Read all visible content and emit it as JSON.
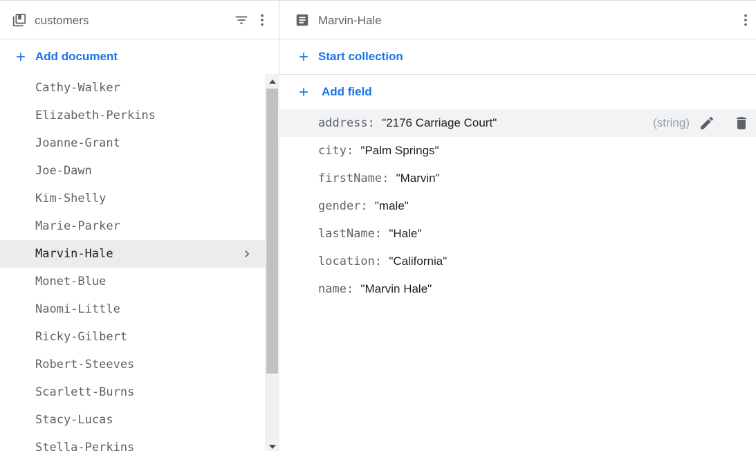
{
  "collection_panel": {
    "title": "customers",
    "add_document_label": "Add document",
    "documents": [
      "Cathy-Walker",
      "Elizabeth-Perkins",
      "Joanne-Grant",
      "Joe-Dawn",
      "Kim-Shelly",
      "Marie-Parker",
      "Marvin-Hale",
      "Monet-Blue",
      "Naomi-Little",
      "Ricky-Gilbert",
      "Robert-Steeves",
      "Scarlett-Burns",
      "Stacy-Lucas",
      "Stella-Perkins"
    ],
    "selected_document": "Marvin-Hale"
  },
  "document_panel": {
    "title": "Marvin-Hale",
    "start_collection_label": "Start collection",
    "add_field_label": "Add field",
    "fields": [
      {
        "key": "address:",
        "value": "\"2176 Carriage Court\"",
        "type": "(string)"
      },
      {
        "key": "city:",
        "value": "\"Palm Springs\""
      },
      {
        "key": "firstName:",
        "value": "\"Marvin\""
      },
      {
        "key": "gender:",
        "value": "\"male\""
      },
      {
        "key": "lastName:",
        "value": "\"Hale\""
      },
      {
        "key": "location:",
        "value": "\"California\""
      },
      {
        "key": "name:",
        "value": "\"Marvin Hale\""
      }
    ]
  },
  "colors": {
    "accent": "#1a73e8",
    "text_secondary": "#5f6368",
    "text_primary": "#202124",
    "selected_bg": "#ececec",
    "divider": "#dadce0"
  },
  "icons": {
    "collection": "collection-stack-icon",
    "filter": "filter-icon",
    "more": "more-vert-icon",
    "document": "document-icon",
    "add": "plus-icon",
    "chevron": "chevron-right-icon",
    "edit": "pencil-icon",
    "delete": "trash-icon"
  }
}
